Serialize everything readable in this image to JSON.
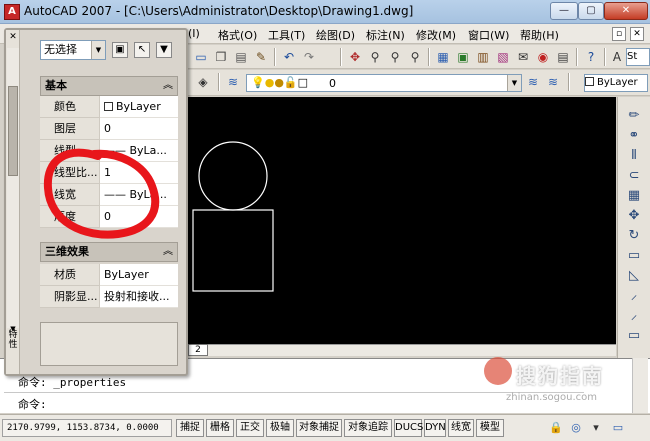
{
  "window": {
    "title": "AutoCAD 2007 - [C:\\Users\\Administrator\\Desktop\\Drawing1.dwg]",
    "minimize_label": "—",
    "maximize_label": "▢",
    "close_label": "✕"
  },
  "menu": {
    "items": [
      "(I)",
      "格式(O)",
      "工具(T)",
      "绘图(D)",
      "标注(N)",
      "修改(M)",
      "窗口(W)",
      "帮助(H)"
    ],
    "restore_label": "▫",
    "close_label": "✕"
  },
  "toolbar": {
    "layer_value": "0",
    "color_value": "ByLayer",
    "style_value": "St"
  },
  "palette": {
    "selection_value": "无选择",
    "side_label": "特性",
    "sections": [
      {
        "title": "基本",
        "collapse": "︽",
        "rows": [
          {
            "name": "颜色",
            "value": "ByLayer",
            "swatch": true
          },
          {
            "name": "图层",
            "value": "0"
          },
          {
            "name": "线型",
            "value": "—— ByLa..."
          },
          {
            "name": "线型比...",
            "value": "1"
          },
          {
            "name": "线宽",
            "value": "—— ByLa..."
          },
          {
            "name": "厚度",
            "value": "0"
          }
        ]
      },
      {
        "title": "三维效果",
        "collapse": "︽",
        "rows": [
          {
            "name": "材质",
            "value": "ByLayer"
          },
          {
            "name": "阴影显...",
            "value": "投射和接收..."
          }
        ]
      }
    ]
  },
  "drawing": {
    "layout_tab": "2",
    "circle_color": "#ffffff",
    "rect_color": "#ffffff",
    "annotation_color": "#e8161b"
  },
  "command": {
    "history": "命令: _properties",
    "prompt": "命令:"
  },
  "status": {
    "coords": "2170.9799, 1153.8734, 0.0000",
    "buttons": [
      "捕捉",
      "栅格",
      "正交",
      "极轴",
      "对象捕捉",
      "对象追踪",
      "DUCS",
      "DYN",
      "线宽",
      "模型"
    ]
  },
  "watermark": {
    "text": "搜狗指南",
    "url": "zhinan.sogou.com"
  }
}
